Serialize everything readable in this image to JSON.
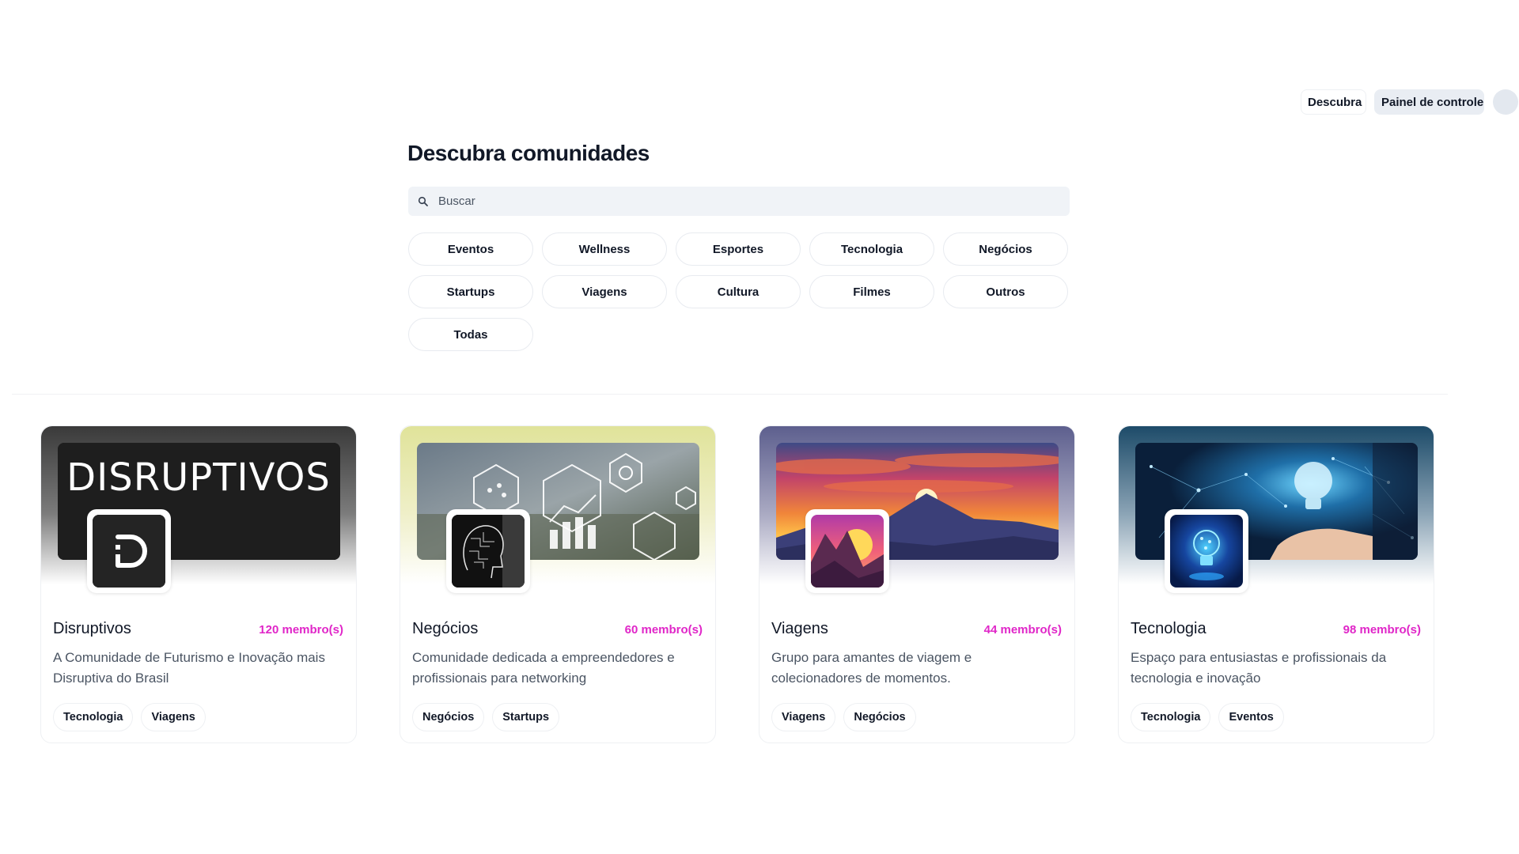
{
  "nav": {
    "discover_label": "Descubra",
    "dashboard_label": "Painel de controle"
  },
  "page": {
    "title": "Descubra comunidades",
    "search_placeholder": "Buscar"
  },
  "categories": [
    "Eventos",
    "Wellness",
    "Esportes",
    "Tecnologia",
    "Negócios",
    "Startups",
    "Viagens",
    "Cultura",
    "Filmes",
    "Outros",
    "Todas"
  ],
  "communities": [
    {
      "name": "Disruptivos",
      "members": "120 membro(s)",
      "description": "A Comunidade de Futurismo e Inovação mais Disruptiva do Brasil",
      "tags": [
        "Tecnologia",
        "Viagens"
      ],
      "banner_text": "DISRUPTIVOS",
      "accent": "#2a2a2a"
    },
    {
      "name": "Negócios",
      "members": "60 membro(s)",
      "description": "Comunidade dedicada a empreendedores e profissionais para networking",
      "tags": [
        "Negócios",
        "Startups"
      ],
      "accent": "#e6e8a8"
    },
    {
      "name": "Viagens",
      "members": "44 membro(s)",
      "description": "Grupo para amantes de viagem e colecionadores de momentos.",
      "tags": [
        "Viagens",
        "Negócios"
      ],
      "accent": "#6b6f98"
    },
    {
      "name": "Tecnologia",
      "members": "98 membro(s)",
      "description": "Espaço para entusiastas e profissionais da tecnologia e inovação",
      "tags": [
        "Tecnologia",
        "Eventos"
      ],
      "accent": "#1f4f70"
    }
  ],
  "colors": {
    "member_count": "#e026c8",
    "search_bg": "#f0f3f7",
    "dashboard_bg": "#e9edf3"
  }
}
